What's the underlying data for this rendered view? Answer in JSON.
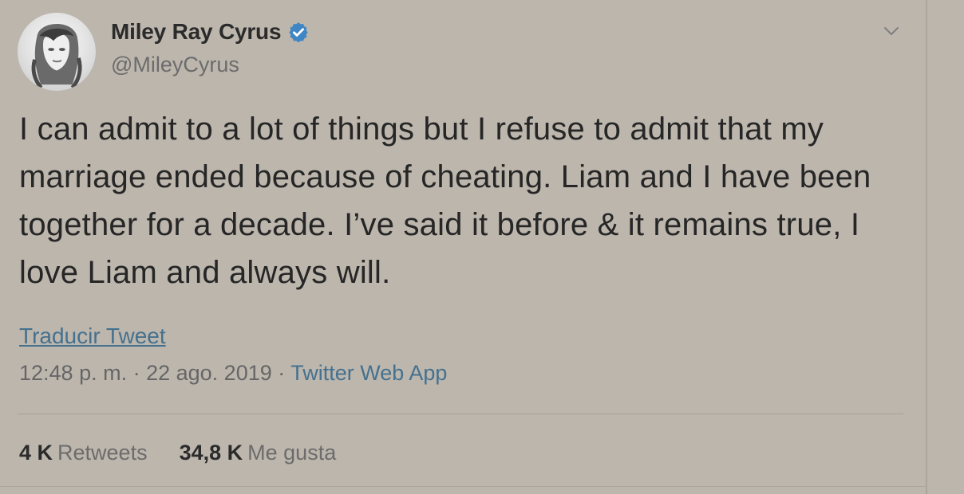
{
  "tweet": {
    "author": {
      "display_name": "Miley Ray Cyrus",
      "handle": "@MileyCyrus",
      "verified_icon": "verified-badge-icon",
      "avatar_icon": "profile-photo"
    },
    "menu_icon": "chevron-down-icon",
    "text": "I can admit to a lot of things but I refuse to admit that my marriage ended because of cheating. Liam and I have been together for a decade. I’ve said it before & it remains true, I love Liam and always will.",
    "translate_label": "Traducir Tweet",
    "meta": {
      "time": "12:48 p. m.",
      "separator_1": " · ",
      "date": "22 ago. 2019",
      "separator_2": " · ",
      "source": "Twitter Web App"
    },
    "stats": {
      "retweets_count": "4 K",
      "retweets_label": "Retweets",
      "likes_count": "34,8 K",
      "likes_label": "Me gusta"
    }
  },
  "colors": {
    "background": "#bcb6ad",
    "link": "#45718f",
    "verified": "#3f86c4",
    "text": "#262626",
    "muted": "#6c6c6c"
  }
}
